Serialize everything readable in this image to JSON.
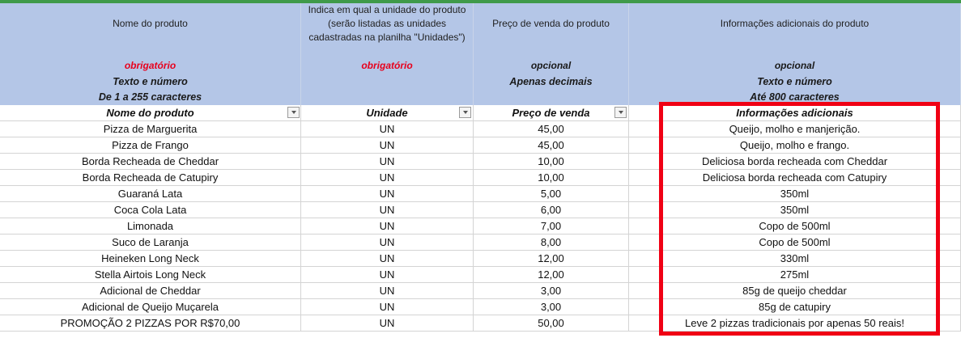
{
  "colors": {
    "header_band": "#b4c6e7",
    "required": "#e8001c",
    "highlight": "#f00014",
    "top_strip": "#3f9a4a"
  },
  "spec_header": {
    "nome": {
      "desc": [
        "Nome do produto"
      ],
      "req": "obrigatório",
      "spec": [
        "Texto e número",
        "De 1 a 255 caracteres"
      ]
    },
    "unidade": {
      "desc": [
        "Indica em qual a unidade do produto",
        "(serão listadas as unidades",
        "cadastradas na planilha \"Unidades\")"
      ],
      "req": "obrigatório",
      "spec": []
    },
    "preco": {
      "desc": [
        "Preço de venda do produto"
      ],
      "req": "opcional",
      "spec": [
        "Apenas decimais"
      ]
    },
    "info": {
      "desc": [
        "Informações adicionais do produto"
      ],
      "req": "opcional",
      "spec": [
        "Texto e número",
        "Até 800 caracteres"
      ]
    }
  },
  "columns": [
    "Nome do produto",
    "Unidade",
    "Preço de venda",
    "Informações adicionais"
  ],
  "rows": [
    [
      "Pizza de Marguerita",
      "UN",
      "45,00",
      "Queijo, molho e manjerição."
    ],
    [
      "Pizza de Frango",
      "UN",
      "45,00",
      "Queijo, molho e frango."
    ],
    [
      "Borda Recheada de Cheddar",
      "UN",
      "10,00",
      "Deliciosa borda recheada com Cheddar"
    ],
    [
      "Borda Recheada de Catupiry",
      "UN",
      "10,00",
      "Deliciosa borda recheada com Catupiry"
    ],
    [
      "Guaraná Lata",
      "UN",
      "5,00",
      "350ml"
    ],
    [
      "Coca Cola Lata",
      "UN",
      "6,00",
      "350ml"
    ],
    [
      "Limonada",
      "UN",
      "7,00",
      "Copo de 500ml"
    ],
    [
      "Suco de Laranja",
      "UN",
      "8,00",
      "Copo de 500ml"
    ],
    [
      "Heineken Long Neck",
      "UN",
      "12,00",
      "330ml"
    ],
    [
      "Stella Airtois Long Neck",
      "UN",
      "12,00",
      "275ml"
    ],
    [
      "Adicional de Cheddar",
      "UN",
      "3,00",
      "85g de queijo cheddar"
    ],
    [
      "Adicional de Queijo Muçarela",
      "UN",
      "3,00",
      "85g de catupiry"
    ],
    [
      "PROMOÇÃO 2 PIZZAS POR R$70,00",
      "UN",
      "50,00",
      "Leve 2 pizzas tradicionais por apenas 50 reais!"
    ]
  ]
}
